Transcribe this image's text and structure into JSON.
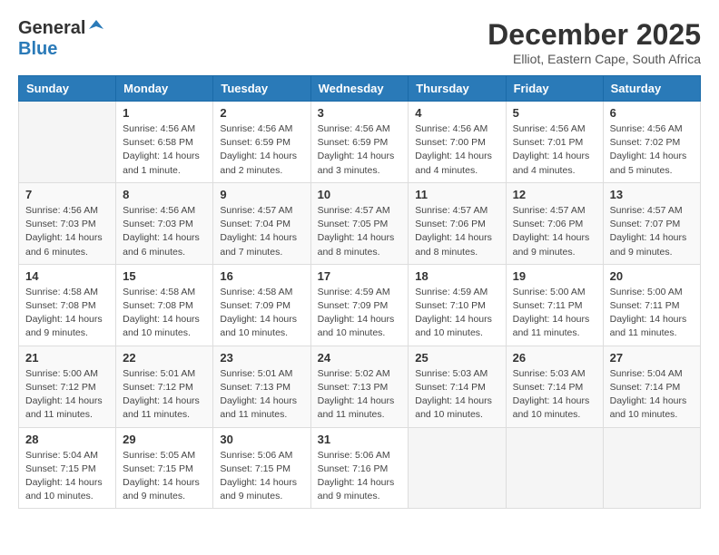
{
  "logo": {
    "general": "General",
    "blue": "Blue"
  },
  "title": "December 2025",
  "location": "Elliot, Eastern Cape, South Africa",
  "weekdays": [
    "Sunday",
    "Monday",
    "Tuesday",
    "Wednesday",
    "Thursday",
    "Friday",
    "Saturday"
  ],
  "weeks": [
    [
      {
        "day": "",
        "info": ""
      },
      {
        "day": "1",
        "info": "Sunrise: 4:56 AM\nSunset: 6:58 PM\nDaylight: 14 hours\nand 1 minute."
      },
      {
        "day": "2",
        "info": "Sunrise: 4:56 AM\nSunset: 6:59 PM\nDaylight: 14 hours\nand 2 minutes."
      },
      {
        "day": "3",
        "info": "Sunrise: 4:56 AM\nSunset: 6:59 PM\nDaylight: 14 hours\nand 3 minutes."
      },
      {
        "day": "4",
        "info": "Sunrise: 4:56 AM\nSunset: 7:00 PM\nDaylight: 14 hours\nand 4 minutes."
      },
      {
        "day": "5",
        "info": "Sunrise: 4:56 AM\nSunset: 7:01 PM\nDaylight: 14 hours\nand 4 minutes."
      },
      {
        "day": "6",
        "info": "Sunrise: 4:56 AM\nSunset: 7:02 PM\nDaylight: 14 hours\nand 5 minutes."
      }
    ],
    [
      {
        "day": "7",
        "info": "Sunrise: 4:56 AM\nSunset: 7:03 PM\nDaylight: 14 hours\nand 6 minutes."
      },
      {
        "day": "8",
        "info": "Sunrise: 4:56 AM\nSunset: 7:03 PM\nDaylight: 14 hours\nand 6 minutes."
      },
      {
        "day": "9",
        "info": "Sunrise: 4:57 AM\nSunset: 7:04 PM\nDaylight: 14 hours\nand 7 minutes."
      },
      {
        "day": "10",
        "info": "Sunrise: 4:57 AM\nSunset: 7:05 PM\nDaylight: 14 hours\nand 8 minutes."
      },
      {
        "day": "11",
        "info": "Sunrise: 4:57 AM\nSunset: 7:06 PM\nDaylight: 14 hours\nand 8 minutes."
      },
      {
        "day": "12",
        "info": "Sunrise: 4:57 AM\nSunset: 7:06 PM\nDaylight: 14 hours\nand 9 minutes."
      },
      {
        "day": "13",
        "info": "Sunrise: 4:57 AM\nSunset: 7:07 PM\nDaylight: 14 hours\nand 9 minutes."
      }
    ],
    [
      {
        "day": "14",
        "info": "Sunrise: 4:58 AM\nSunset: 7:08 PM\nDaylight: 14 hours\nand 9 minutes."
      },
      {
        "day": "15",
        "info": "Sunrise: 4:58 AM\nSunset: 7:08 PM\nDaylight: 14 hours\nand 10 minutes."
      },
      {
        "day": "16",
        "info": "Sunrise: 4:58 AM\nSunset: 7:09 PM\nDaylight: 14 hours\nand 10 minutes."
      },
      {
        "day": "17",
        "info": "Sunrise: 4:59 AM\nSunset: 7:09 PM\nDaylight: 14 hours\nand 10 minutes."
      },
      {
        "day": "18",
        "info": "Sunrise: 4:59 AM\nSunset: 7:10 PM\nDaylight: 14 hours\nand 10 minutes."
      },
      {
        "day": "19",
        "info": "Sunrise: 5:00 AM\nSunset: 7:11 PM\nDaylight: 14 hours\nand 11 minutes."
      },
      {
        "day": "20",
        "info": "Sunrise: 5:00 AM\nSunset: 7:11 PM\nDaylight: 14 hours\nand 11 minutes."
      }
    ],
    [
      {
        "day": "21",
        "info": "Sunrise: 5:00 AM\nSunset: 7:12 PM\nDaylight: 14 hours\nand 11 minutes."
      },
      {
        "day": "22",
        "info": "Sunrise: 5:01 AM\nSunset: 7:12 PM\nDaylight: 14 hours\nand 11 minutes."
      },
      {
        "day": "23",
        "info": "Sunrise: 5:01 AM\nSunset: 7:13 PM\nDaylight: 14 hours\nand 11 minutes."
      },
      {
        "day": "24",
        "info": "Sunrise: 5:02 AM\nSunset: 7:13 PM\nDaylight: 14 hours\nand 11 minutes."
      },
      {
        "day": "25",
        "info": "Sunrise: 5:03 AM\nSunset: 7:14 PM\nDaylight: 14 hours\nand 10 minutes."
      },
      {
        "day": "26",
        "info": "Sunrise: 5:03 AM\nSunset: 7:14 PM\nDaylight: 14 hours\nand 10 minutes."
      },
      {
        "day": "27",
        "info": "Sunrise: 5:04 AM\nSunset: 7:14 PM\nDaylight: 14 hours\nand 10 minutes."
      }
    ],
    [
      {
        "day": "28",
        "info": "Sunrise: 5:04 AM\nSunset: 7:15 PM\nDaylight: 14 hours\nand 10 minutes."
      },
      {
        "day": "29",
        "info": "Sunrise: 5:05 AM\nSunset: 7:15 PM\nDaylight: 14 hours\nand 9 minutes."
      },
      {
        "day": "30",
        "info": "Sunrise: 5:06 AM\nSunset: 7:15 PM\nDaylight: 14 hours\nand 9 minutes."
      },
      {
        "day": "31",
        "info": "Sunrise: 5:06 AM\nSunset: 7:16 PM\nDaylight: 14 hours\nand 9 minutes."
      },
      {
        "day": "",
        "info": ""
      },
      {
        "day": "",
        "info": ""
      },
      {
        "day": "",
        "info": ""
      }
    ]
  ]
}
